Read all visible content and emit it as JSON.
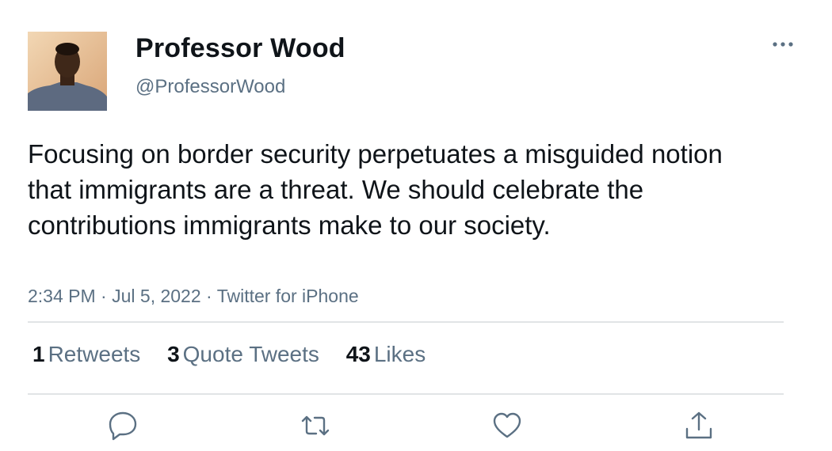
{
  "author": {
    "display_name": "Professor Wood",
    "handle": "@ProfessorWood"
  },
  "tweet": {
    "text": "Focusing on border security perpetuates a misguided notion that immigrants are a threat. We should celebrate the contributions immigrants make to our society.",
    "time": "2:34 PM",
    "separator": "·",
    "date": "Jul 5, 2022",
    "source": "Twitter for iPhone"
  },
  "stats": {
    "retweets_count": "1",
    "retweets_label": "Retweets",
    "quotes_count": "3",
    "quotes_label": "Quote Tweets",
    "likes_count": "43",
    "likes_label": "Likes"
  },
  "icons": {
    "more": "more-horizontal-icon",
    "reply": "reply-icon",
    "retweet": "retweet-icon",
    "like": "heart-icon",
    "share": "share-icon"
  },
  "colors": {
    "text_primary": "#0f1419",
    "text_secondary": "#5b7083",
    "divider": "#e1e4e6"
  }
}
